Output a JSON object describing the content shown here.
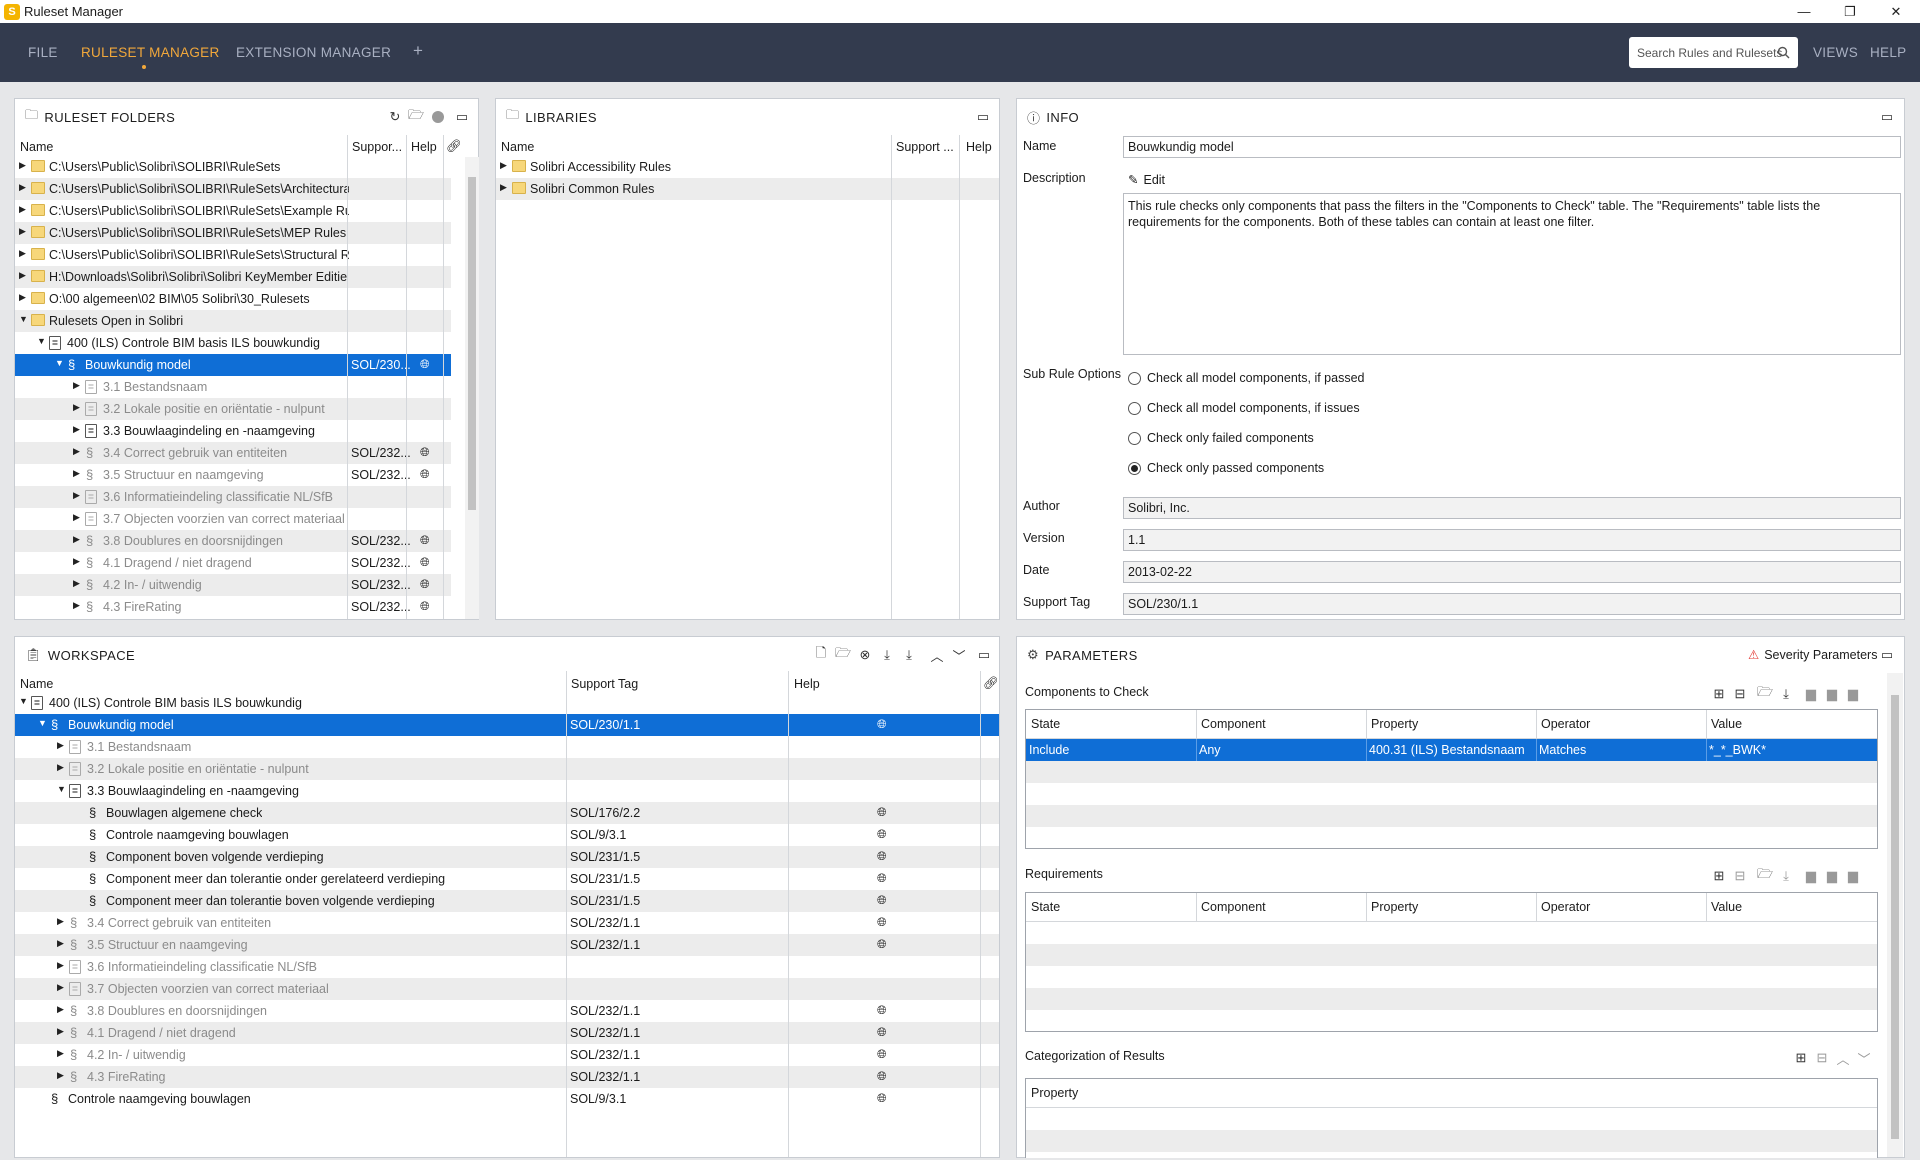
{
  "window": {
    "title": "Ruleset Manager",
    "logo_letter": "S"
  },
  "menu": {
    "file": "FILE",
    "ruleset_manager": "RULESET MANAGER",
    "extension_manager": "EXTENSION MANAGER",
    "add": "+",
    "search_placeholder": "Search Rules and Rulesets",
    "views": "VIEWS",
    "help": "HELP"
  },
  "ruleset_folders": {
    "title": "RULESET FOLDERS",
    "columns": [
      "Name",
      "Suppor...",
      "Help"
    ],
    "rows": [
      {
        "label": "C:\\Users\\Public\\Solibri\\SOLIBRI\\RuleSets",
        "type": "folder",
        "level": 0,
        "expander": "▶"
      },
      {
        "label": "C:\\Users\\Public\\Solibri\\SOLIBRI\\RuleSets\\Architectural",
        "type": "folder",
        "level": 0,
        "expander": "▶"
      },
      {
        "label": "C:\\Users\\Public\\Solibri\\SOLIBRI\\RuleSets\\Example Rule",
        "type": "folder",
        "level": 0,
        "expander": "▶"
      },
      {
        "label": "C:\\Users\\Public\\Solibri\\SOLIBRI\\RuleSets\\MEP Rules",
        "type": "folder",
        "level": 0,
        "expander": "▶"
      },
      {
        "label": "C:\\Users\\Public\\Solibri\\SOLIBRI\\RuleSets\\Structural Rul",
        "type": "folder",
        "level": 0,
        "expander": "▶"
      },
      {
        "label": "H:\\Downloads\\Solibri\\Solibri\\Solibri KeyMember Editie",
        "type": "folder",
        "level": 0,
        "expander": "▶"
      },
      {
        "label": "O:\\00 algemeen\\02 BIM\\05 Solibri\\30_Rulesets",
        "type": "folder",
        "level": 0,
        "expander": "▶"
      },
      {
        "label": "Rulesets Open in Solibri",
        "type": "folder",
        "level": 0,
        "expander": "▼"
      },
      {
        "label": "400 (ILS) Controle BIM basis ILS bouwkundig",
        "type": "ruleset",
        "level": 1,
        "expander": "▼"
      },
      {
        "label": "Bouwkundig model",
        "type": "rule",
        "level": 2,
        "expander": "▼",
        "tag": "SOL/230...",
        "globe": true,
        "selected": true
      },
      {
        "label": "3.1 Bestandsnaam",
        "type": "ruleset",
        "level": 3,
        "expander": "▶",
        "dim": true
      },
      {
        "label": "3.2 Lokale positie en oriëntatie - nulpunt",
        "type": "ruleset",
        "level": 3,
        "expander": "▶",
        "dim": true
      },
      {
        "label": "3.3 Bouwlaagindeling en -naamgeving",
        "type": "ruleset",
        "level": 3,
        "expander": "▶"
      },
      {
        "label": "3.4 Correct gebruik van entiteiten",
        "type": "rule",
        "level": 3,
        "expander": "▶",
        "tag": "SOL/232...",
        "globe": true,
        "dim": true
      },
      {
        "label": "3.5 Structuur en naamgeving",
        "type": "rule",
        "level": 3,
        "expander": "▶",
        "tag": "SOL/232...",
        "globe": true,
        "dim": true
      },
      {
        "label": "3.6 Informatieindeling classificatie NL/SfB",
        "type": "ruleset",
        "level": 3,
        "expander": "▶",
        "dim": true
      },
      {
        "label": "3.7 Objecten voorzien van correct materiaal",
        "type": "ruleset",
        "level": 3,
        "expander": "▶",
        "dim": true
      },
      {
        "label": "3.8 Doublures en doorsnijdingen",
        "type": "rule",
        "level": 3,
        "expander": "▶",
        "tag": "SOL/232...",
        "globe": true,
        "dim": true
      },
      {
        "label": "4.1 Dragend / niet dragend",
        "type": "rule",
        "level": 3,
        "expander": "▶",
        "tag": "SOL/232...",
        "globe": true,
        "dim": true
      },
      {
        "label": "4.2 In- / uitwendig",
        "type": "rule",
        "level": 3,
        "expander": "▶",
        "tag": "SOL/232...",
        "globe": true,
        "dim": true
      },
      {
        "label": "4.3 FireRating",
        "type": "rule",
        "level": 3,
        "expander": "▶",
        "tag": "SOL/232...",
        "globe": true,
        "dim": true
      }
    ]
  },
  "libraries": {
    "title": "LIBRARIES",
    "columns": [
      "Name",
      "Support ...",
      "Help"
    ],
    "rows": [
      {
        "label": "Solibri Accessibility Rules",
        "type": "folder",
        "level": 0,
        "expander": "▶"
      },
      {
        "label": "Solibri Common Rules",
        "type": "folder",
        "level": 0,
        "expander": "▶"
      }
    ]
  },
  "info": {
    "title": "INFO",
    "name_label": "Name",
    "name_value": "Bouwkundig model",
    "description_label": "Description",
    "edit_label": "Edit",
    "description_text": "This rule checks only components that pass the filters in the \"Components to Check\" table. The \"Requirements\" table lists the requirements for the components. Both of these tables can contain at least one filter.",
    "sub_rule_label": "Sub Rule Options",
    "options": [
      {
        "label": "Check all model components, if passed",
        "checked": false
      },
      {
        "label": "Check all model components, if issues",
        "checked": false
      },
      {
        "label": "Check only failed components",
        "checked": false
      },
      {
        "label": "Check only passed components",
        "checked": true
      }
    ],
    "author_label": "Author",
    "author_value": "Solibri, Inc.",
    "version_label": "Version",
    "version_value": "1.1",
    "date_label": "Date",
    "date_value": "2013-02-22",
    "support_label": "Support Tag",
    "support_value": "SOL/230/1.1"
  },
  "workspace": {
    "title": "WORKSPACE",
    "columns": [
      "Name",
      "Support Tag",
      "Help"
    ],
    "rows": [
      {
        "label": "400 (ILS) Controle BIM basis ILS bouwkundig",
        "type": "ruleset",
        "level": 0,
        "expander": "▼"
      },
      {
        "label": "Bouwkundig model",
        "type": "rule",
        "level": 1,
        "expander": "▼",
        "tag": "SOL/230/1.1",
        "globe": true,
        "selected": true
      },
      {
        "label": "3.1 Bestandsnaam",
        "type": "ruleset",
        "level": 2,
        "expander": "▶",
        "dim": true
      },
      {
        "label": "3.2 Lokale positie en oriëntatie - nulpunt",
        "type": "ruleset",
        "level": 2,
        "expander": "▶",
        "dim": true
      },
      {
        "label": "3.3 Bouwlaagindeling en -naamgeving",
        "type": "ruleset",
        "level": 2,
        "expander": "▼"
      },
      {
        "label": "Bouwlagen algemene check",
        "type": "rule",
        "level": 3,
        "expander": "",
        "tag": "SOL/176/2.2",
        "globe": true
      },
      {
        "label": "Controle naamgeving bouwlagen",
        "type": "rule",
        "level": 3,
        "expander": "",
        "tag": "SOL/9/3.1",
        "globe": true
      },
      {
        "label": "Component boven volgende verdieping",
        "type": "rule",
        "level": 3,
        "expander": "",
        "tag": "SOL/231/1.5",
        "globe": true
      },
      {
        "label": "Component meer dan tolerantie onder gerelateerd verdieping",
        "type": "rule",
        "level": 3,
        "expander": "",
        "tag": "SOL/231/1.5",
        "globe": true
      },
      {
        "label": "Component meer dan tolerantie boven volgende verdieping",
        "type": "rule",
        "level": 3,
        "expander": "",
        "tag": "SOL/231/1.5",
        "globe": true
      },
      {
        "label": "3.4 Correct gebruik van entiteiten",
        "type": "rule",
        "level": 2,
        "expander": "▶",
        "tag": "SOL/232/1.1",
        "globe": true,
        "dim": true
      },
      {
        "label": "3.5 Structuur en naamgeving",
        "type": "rule",
        "level": 2,
        "expander": "▶",
        "tag": "SOL/232/1.1",
        "globe": true,
        "dim": true
      },
      {
        "label": "3.6 Informatieindeling classificatie NL/SfB",
        "type": "ruleset",
        "level": 2,
        "expander": "▶",
        "dim": true
      },
      {
        "label": "3.7 Objecten voorzien van correct materiaal",
        "type": "ruleset",
        "level": 2,
        "expander": "▶",
        "dim": true
      },
      {
        "label": "3.8 Doublures en doorsnijdingen",
        "type": "rule",
        "level": 2,
        "expander": "▶",
        "tag": "SOL/232/1.1",
        "globe": true,
        "dim": true
      },
      {
        "label": "4.1 Dragend / niet dragend",
        "type": "rule",
        "level": 2,
        "expander": "▶",
        "tag": "SOL/232/1.1",
        "globe": true,
        "dim": true
      },
      {
        "label": "4.2 In- / uitwendig",
        "type": "rule",
        "level": 2,
        "expander": "▶",
        "tag": "SOL/232/1.1",
        "globe": true,
        "dim": true
      },
      {
        "label": "4.3 FireRating",
        "type": "rule",
        "level": 2,
        "expander": "▶",
        "tag": "SOL/232/1.1",
        "globe": true,
        "dim": true
      },
      {
        "label": "Controle naamgeving bouwlagen",
        "type": "rule",
        "level": 1,
        "expander": "",
        "tag": "SOL/9/3.1",
        "globe": true
      }
    ]
  },
  "parameters": {
    "title": "PARAMETERS",
    "severity_label": "Severity Parameters",
    "components_title": "Components to Check",
    "table_columns": [
      "State",
      "Component",
      "Property",
      "Operator",
      "Value"
    ],
    "components_rows": [
      [
        "Include",
        "Any",
        "400.31 (ILS) Bestandsnaam",
        "Matches",
        "*_*_BWK*"
      ]
    ],
    "requirements_title": "Requirements",
    "categorization_title": "Categorization of Results",
    "categorization_column": "Property"
  },
  "colors": {
    "menubar": "#333b4e",
    "accent": "#f2a83b",
    "selection": "#0f6ed6"
  }
}
